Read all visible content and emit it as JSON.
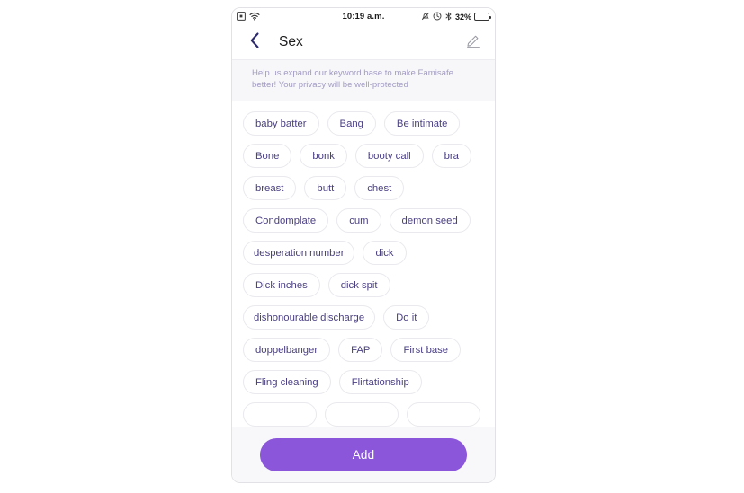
{
  "status_bar": {
    "left_icons": [
      "sim-card-icon",
      "wifi-icon"
    ],
    "time": "10:19 a.m.",
    "right_icons": [
      "alarm-muted-icon",
      "location-icon",
      "bluetooth-icon"
    ],
    "battery_percent": "32%",
    "battery_level": 32,
    "battery_color": "#3ddc84"
  },
  "nav": {
    "back_icon": "chevron-left-icon",
    "title": "Sex",
    "edit_icon": "pencil-edit-icon"
  },
  "banner": {
    "text": "Help us expand our keyword base to make Famisafe better! Your privacy will be well-protected",
    "text_color": "#a39bc4",
    "background": "#f7f7fa"
  },
  "keywords": {
    "rows": [
      [
        "baby batter",
        "Bang",
        "Be intimate"
      ],
      [
        "Bone",
        "bonk",
        "booty call",
        "bra"
      ],
      [
        "breast",
        "butt",
        "chest"
      ],
      [
        "Condomplate",
        "cum",
        "demon seed"
      ],
      [
        "desperation number",
        "dick"
      ],
      [
        "Dick inches",
        "dick spit"
      ],
      [
        "dishonourable discharge",
        "Do it"
      ],
      [
        "doppelbanger",
        "FAP",
        "First base"
      ],
      [
        "Fling cleaning",
        "Flirtationship"
      ],
      [
        "",
        "",
        ""
      ]
    ],
    "chip_text_color": "#4a4083",
    "chip_border_color": "#e9e9ee"
  },
  "bottom": {
    "add_label": "Add",
    "add_color": "#8c56db",
    "bar_background": "#f8f8fa"
  }
}
